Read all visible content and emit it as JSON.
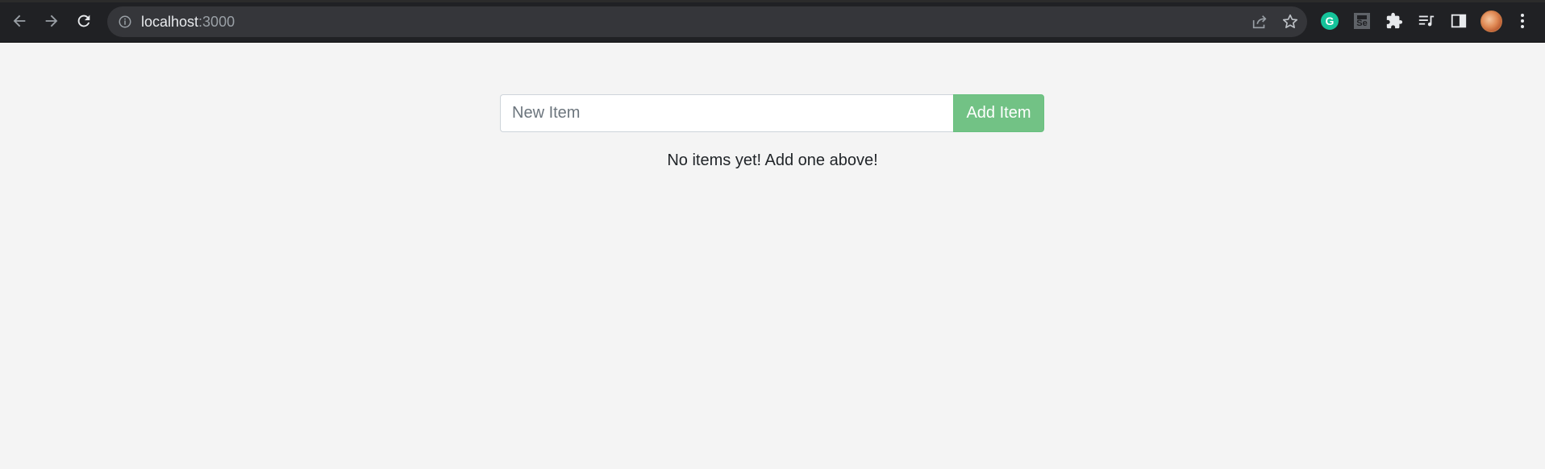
{
  "browser": {
    "url_host": "localhost",
    "url_port": ":3000",
    "toolbar_icons": [
      "back-icon",
      "forward-icon",
      "reload-icon",
      "info-icon",
      "share-icon",
      "bookmark-star-icon",
      "grammarly-icon",
      "selenium-icon",
      "extensions-puzzle-icon",
      "media-queue-icon",
      "side-panel-icon",
      "profile-avatar",
      "more-options-icon"
    ],
    "grammarly_letter": "G",
    "selenium_label": "Se"
  },
  "app": {
    "input_placeholder": "New Item",
    "input_value": "",
    "add_button_label": "Add Item",
    "empty_message": "No items yet! Add one above!",
    "colors": {
      "add_button": "#72c285",
      "background": "#f4f4f4"
    }
  }
}
